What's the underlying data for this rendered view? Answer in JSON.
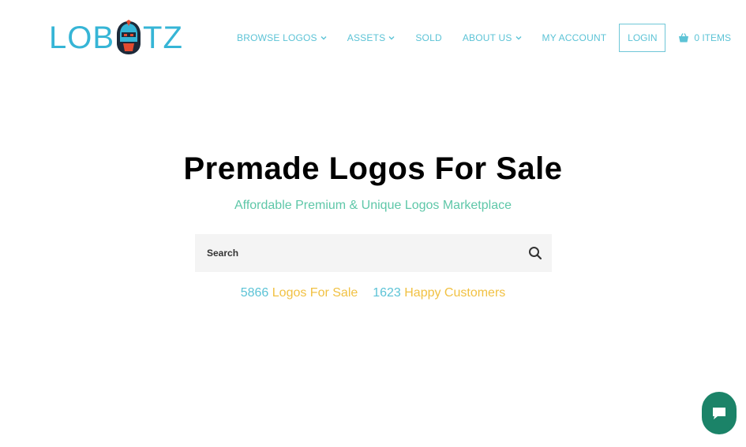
{
  "brand": {
    "part1": "LOB",
    "part2": "TZ"
  },
  "nav": {
    "items": [
      {
        "label": "BROWSE LOGOS",
        "has_dropdown": true
      },
      {
        "label": "ASSETS",
        "has_dropdown": true
      },
      {
        "label": "SOLD",
        "has_dropdown": false
      },
      {
        "label": "ABOUT US",
        "has_dropdown": true
      },
      {
        "label": "MY ACCOUNT",
        "has_dropdown": false
      }
    ],
    "login_label": "LOGIN",
    "cart_label": "0 ITEMS"
  },
  "hero": {
    "title": "Premade Logos For Sale",
    "subtitle": "Affordable Premium & Unique Logos Marketplace"
  },
  "search": {
    "placeholder": "Search"
  },
  "stats": {
    "logos_count": "5866",
    "logos_label": "Logos For Sale",
    "customers_count": "1623",
    "customers_label": "Happy Customers"
  },
  "colors": {
    "accent_blue": "#36b5d6",
    "logo_red": "#e34b2f",
    "subtitle_green": "#5ec7a8",
    "stat_yellow": "#f1c143",
    "chat_green": "#1b8368"
  },
  "icons": {
    "brand_mask": "helmet-mask-icon",
    "cart": "basket-icon",
    "search": "magnifier-icon",
    "chat": "chat-bubble-icon"
  }
}
